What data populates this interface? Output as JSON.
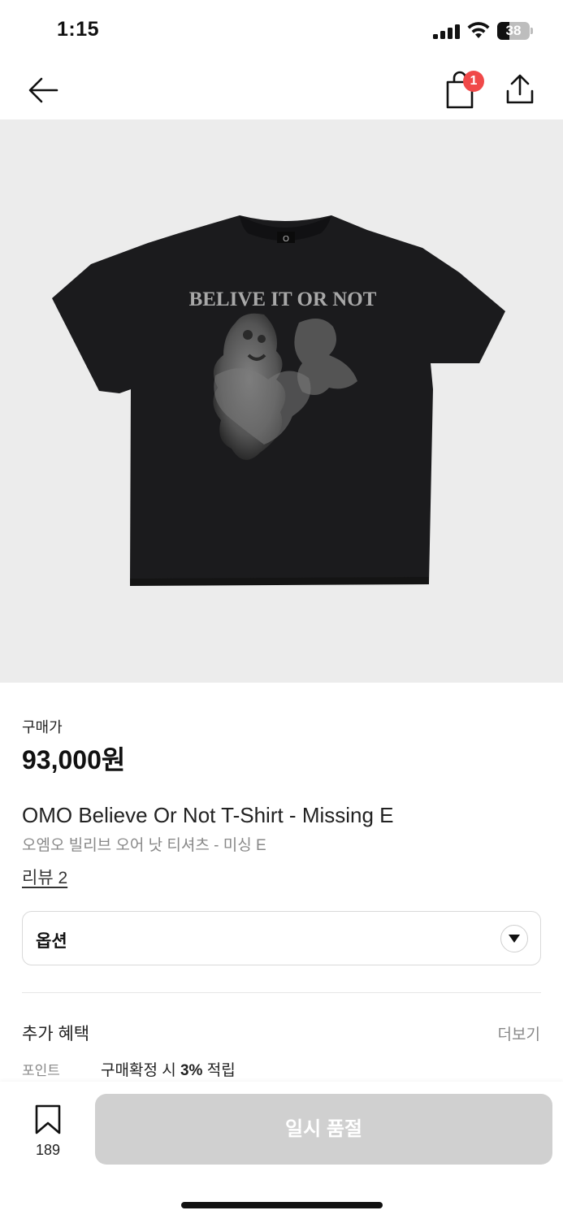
{
  "status_bar": {
    "time": "1:15",
    "battery_level": "38",
    "icons": [
      "signal-icon",
      "wifi-icon",
      "battery-icon"
    ]
  },
  "nav": {
    "back_icon": "arrow-left-icon",
    "cart_icon": "shopping-bag-icon",
    "cart_badge": "1",
    "share_icon": "share-upload-icon",
    "badge_color": "#f04949"
  },
  "product": {
    "image": {
      "print_text": "BELIVE IT OR NOT",
      "neck_label": "O",
      "background": "#ececec"
    },
    "price_label": "구매가",
    "price": "93,000원",
    "title_en": "OMO Believe Or Not T-Shirt - Missing E",
    "title_ko": "오엠오 빌리브 오어 낫 티셔츠 - 미싱 E",
    "review_link": "리뷰 2"
  },
  "options": {
    "label": "옵션",
    "icon": "chevron-down-icon"
  },
  "benefits": {
    "title": "추가 혜택",
    "more": "더보기",
    "point_label": "포인트",
    "point_text_before": "구매확정 시 ",
    "point_rate": "3%",
    "point_text_after": " 적립"
  },
  "bottom_bar": {
    "bookmark_icon": "bookmark-icon",
    "bookmark_count": "189",
    "action_label": "일시 품절",
    "action_color": "#d0d0d0"
  }
}
